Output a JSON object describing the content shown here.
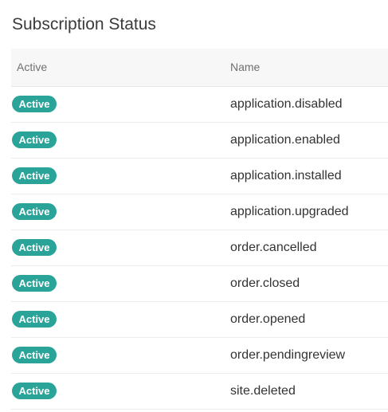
{
  "page": {
    "title": "Subscription Status"
  },
  "table": {
    "columns": {
      "active": "Active",
      "name": "Name"
    },
    "rows": [
      {
        "status": "Active",
        "name": "application.disabled"
      },
      {
        "status": "Active",
        "name": "application.enabled"
      },
      {
        "status": "Active",
        "name": "application.installed"
      },
      {
        "status": "Active",
        "name": "application.upgraded"
      },
      {
        "status": "Active",
        "name": "order.cancelled"
      },
      {
        "status": "Active",
        "name": "order.closed"
      },
      {
        "status": "Active",
        "name": "order.opened"
      },
      {
        "status": "Active",
        "name": "order.pendingreview"
      },
      {
        "status": "Active",
        "name": "site.deleted"
      }
    ]
  },
  "colors": {
    "badge": "#2aa398",
    "header_bg": "#f7f7f7"
  }
}
